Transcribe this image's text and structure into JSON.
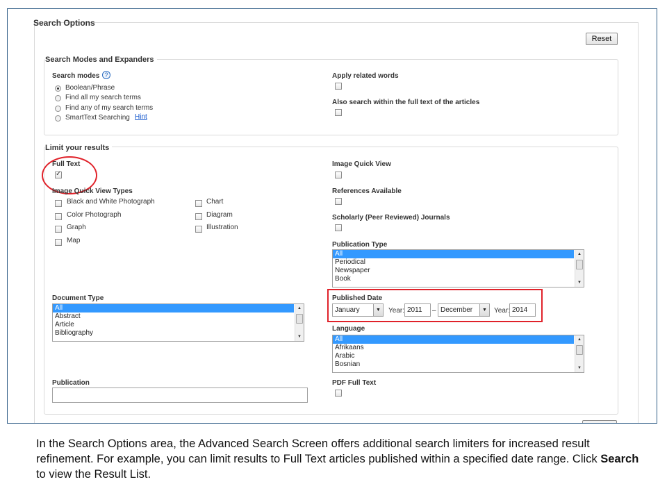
{
  "search_options": {
    "title": "Search Options",
    "reset_label": "Reset"
  },
  "modes": {
    "title": "Search Modes and Expanders",
    "search_modes_label": "Search modes",
    "help_glyph": "?",
    "options": [
      "Boolean/Phrase",
      "Find all my search terms",
      "Find any of my search terms",
      "SmartText Searching"
    ],
    "selected_index": 0,
    "hint_label": "Hint",
    "apply_related_label": "Apply related words",
    "apply_related_checked": false,
    "fulltext_search_label": "Also search within the full text of the articles",
    "fulltext_search_checked": false
  },
  "limits": {
    "title": "Limit your results",
    "full_text_label": "Full Text",
    "full_text_checked": true,
    "iqv_types_label": "Image Quick View Types",
    "iqv_types_left": [
      "Black and White Photograph",
      "Color Photograph",
      "Graph",
      "Map"
    ],
    "iqv_types_right": [
      "Chart",
      "Diagram",
      "Illustration"
    ],
    "image_quick_view_label": "Image Quick View",
    "references_label": "References Available",
    "scholarly_label": "Scholarly (Peer Reviewed) Journals",
    "publication_type_label": "Publication Type",
    "publication_type_options": [
      "All",
      "Periodical",
      "Newspaper",
      "Book"
    ],
    "document_type_label": "Document Type",
    "document_type_options": [
      "All",
      "Abstract",
      "Article",
      "Bibliography"
    ],
    "published_date_label": "Published Date",
    "from_month": "January",
    "year_label": "Year:",
    "from_year": "2011",
    "date_separator": "–",
    "to_month": "December",
    "to_year": "2014",
    "language_label": "Language",
    "language_options": [
      "All",
      "Afrikaans",
      "Arabic",
      "Bosnian"
    ],
    "publication_label": "Publication",
    "publication_value": "",
    "pdf_full_text_label": "PDF Full Text"
  },
  "caption": {
    "part1": "In the Search Options area, the Advanced Search Screen offers additional search limiters for increased result refinement. For example, you can limit results to Full Text articles published within a specified date range. Click ",
    "bold": "Search",
    "part2": " to view the Result List."
  },
  "colors": {
    "frame_border": "#2e5c86",
    "highlight": "#e0222a",
    "list_selection": "#3399ff",
    "link": "#1155cc"
  }
}
